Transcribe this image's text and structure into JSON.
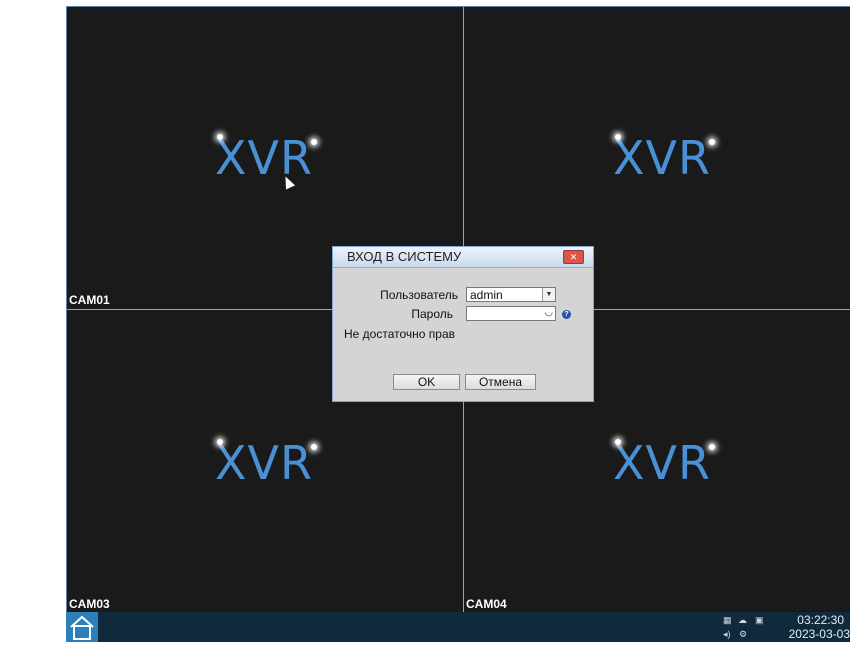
{
  "cameras": [
    {
      "logo": "XVR",
      "label": "CAM01"
    },
    {
      "logo": "XVR",
      "label": ""
    },
    {
      "logo": "XVR",
      "label": "CAM03"
    },
    {
      "logo": "XVR",
      "label": "CAM04"
    }
  ],
  "dialog": {
    "title": "ВХОД В СИСТЕМУ",
    "user_label": "Пользователь",
    "user_value": "admin",
    "password_label": "Пароль",
    "password_value": "",
    "message": "Не достаточно прав",
    "ok_label": "OK",
    "cancel_label": "Отмена"
  },
  "taskbar": {
    "time": "03:22:30",
    "date": "2023-03-03"
  },
  "colors": {
    "logo": "#4a90d6",
    "taskbar": "#0f2a3c",
    "home_button": "#2c7fb8"
  }
}
